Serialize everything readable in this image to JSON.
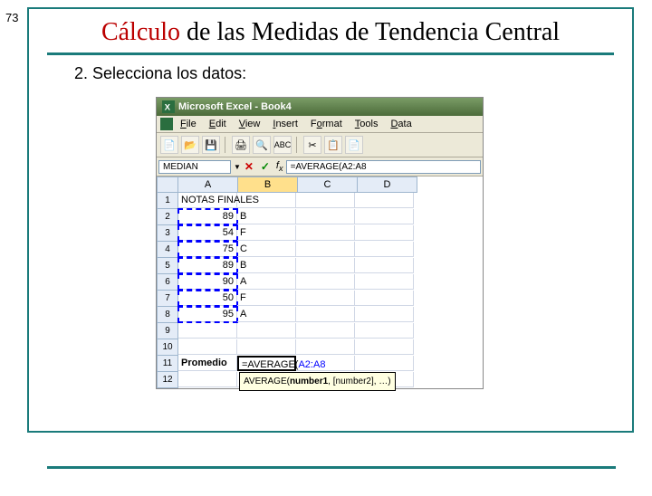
{
  "slide_number": "73",
  "title": {
    "w1": "Cálculo",
    "w2": "de",
    "w3": "las",
    "w4": "Medidas",
    "w5": "de",
    "w6": "Tendencia",
    "w7": "Central"
  },
  "step_text": "2.  Selecciona los datos:",
  "excel": {
    "app_title": "Microsoft Excel - Book4",
    "menus": [
      "File",
      "Edit",
      "View",
      "Insert",
      "Format",
      "Tools",
      "Data"
    ],
    "namebox": "MEDIAN",
    "formula": "=AVERAGE(A2:A8",
    "tooltip_sig": "AVERAGE(",
    "tooltip_arg1": "number1",
    "tooltip_rest": ", [number2], …)",
    "columns": [
      "A",
      "B",
      "C",
      "D"
    ],
    "rows": [
      {
        "n": "1",
        "a": "NOTAS FINALES",
        "b": "",
        "c": "",
        "d": ""
      },
      {
        "n": "2",
        "a": "89",
        "b": "B",
        "c": "",
        "d": ""
      },
      {
        "n": "3",
        "a": "54",
        "b": "F",
        "c": "",
        "d": ""
      },
      {
        "n": "4",
        "a": "75",
        "b": "C",
        "c": "",
        "d": ""
      },
      {
        "n": "5",
        "a": "89",
        "b": "B",
        "c": "",
        "d": ""
      },
      {
        "n": "6",
        "a": "90",
        "b": "A",
        "c": "",
        "d": ""
      },
      {
        "n": "7",
        "a": "50",
        "b": "F",
        "c": "",
        "d": ""
      },
      {
        "n": "8",
        "a": "95",
        "b": "A",
        "c": "",
        "d": ""
      },
      {
        "n": "9",
        "a": "",
        "b": "",
        "c": "",
        "d": ""
      },
      {
        "n": "10",
        "a": "",
        "b": "",
        "c": "",
        "d": ""
      },
      {
        "n": "11",
        "a": "Promedio",
        "b": "=AVERAGE(A2:A8",
        "c": "",
        "d": ""
      },
      {
        "n": "12",
        "a": "",
        "b": "",
        "c": "",
        "d": ""
      }
    ]
  }
}
